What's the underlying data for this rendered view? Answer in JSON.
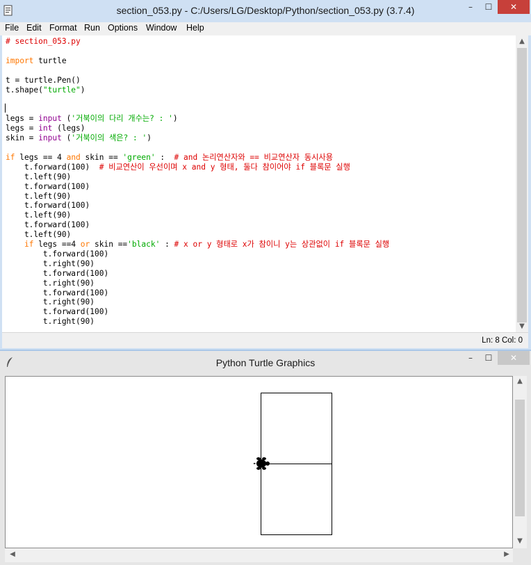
{
  "editor_window": {
    "title": "section_053.py - C:/Users/LG/Desktop/Python/section_053.py (3.7.4)",
    "controls": {
      "minimize": "–",
      "maximize": "☐",
      "close": "✕"
    },
    "menu": [
      "File",
      "Edit",
      "Format",
      "Run",
      "Options",
      "Window",
      "Help"
    ],
    "status": "Ln: 8  Col: 0"
  },
  "code_lines": [
    [
      {
        "t": "# section_053.py",
        "c": "cm"
      }
    ],
    [],
    [
      {
        "t": "import",
        "c": "kw"
      },
      {
        "t": " turtle",
        "c": ""
      }
    ],
    [],
    [
      {
        "t": "t = turtle.Pen()",
        "c": ""
      }
    ],
    [
      {
        "t": "t.shape(",
        "c": ""
      },
      {
        "t": "\"turtle\"",
        "c": "st"
      },
      {
        "t": ")",
        "c": ""
      }
    ],
    [],
    [],
    [
      {
        "t": "legs = ",
        "c": ""
      },
      {
        "t": "input",
        "c": "bi"
      },
      {
        "t": " (",
        "c": ""
      },
      {
        "t": "'거북이의 다리 개수는? : '",
        "c": "st"
      },
      {
        "t": ")",
        "c": ""
      }
    ],
    [
      {
        "t": "legs = ",
        "c": ""
      },
      {
        "t": "int",
        "c": "bi"
      },
      {
        "t": " (legs)",
        "c": ""
      }
    ],
    [
      {
        "t": "skin = ",
        "c": ""
      },
      {
        "t": "input",
        "c": "bi"
      },
      {
        "t": " (",
        "c": ""
      },
      {
        "t": "'거북이의 색은? : '",
        "c": "st"
      },
      {
        "t": ")",
        "c": ""
      }
    ],
    [],
    [
      {
        "t": "if",
        "c": "kw"
      },
      {
        "t": " legs == 4 ",
        "c": ""
      },
      {
        "t": "and",
        "c": "kw"
      },
      {
        "t": " skin == ",
        "c": ""
      },
      {
        "t": "'green'",
        "c": "st"
      },
      {
        "t": " :  ",
        "c": ""
      },
      {
        "t": "# and 논리연산자와 == 비교연산자 동시사용",
        "c": "cm"
      }
    ],
    [
      {
        "t": "    t.forward(100)  ",
        "c": ""
      },
      {
        "t": "# 비교연산이 우선이며 x and y 형태, 둘다 참이어야 if 블록문 실행",
        "c": "cm"
      }
    ],
    [
      {
        "t": "    t.left(90)",
        "c": ""
      }
    ],
    [
      {
        "t": "    t.forward(100)",
        "c": ""
      }
    ],
    [
      {
        "t": "    t.left(90)",
        "c": ""
      }
    ],
    [
      {
        "t": "    t.forward(100)",
        "c": ""
      }
    ],
    [
      {
        "t": "    t.left(90)",
        "c": ""
      }
    ],
    [
      {
        "t": "    t.forward(100)",
        "c": ""
      }
    ],
    [
      {
        "t": "    t.left(90)",
        "c": ""
      }
    ],
    [
      {
        "t": "    ",
        "c": ""
      },
      {
        "t": "if",
        "c": "kw"
      },
      {
        "t": " legs ==4 ",
        "c": ""
      },
      {
        "t": "or",
        "c": "kw"
      },
      {
        "t": " skin ==",
        "c": ""
      },
      {
        "t": "'black'",
        "c": "st"
      },
      {
        "t": " : ",
        "c": ""
      },
      {
        "t": "# x or y 형태로 x가 참이니 y는 상관없이 if 블록문 실행",
        "c": "cm"
      }
    ],
    [
      {
        "t": "        t.forward(100)",
        "c": ""
      }
    ],
    [
      {
        "t": "        t.right(90)",
        "c": ""
      }
    ],
    [
      {
        "t": "        t.forward(100)",
        "c": ""
      }
    ],
    [
      {
        "t": "        t.right(90)",
        "c": ""
      }
    ],
    [
      {
        "t": "        t.forward(100)",
        "c": ""
      }
    ],
    [
      {
        "t": "        t.right(90)",
        "c": ""
      }
    ],
    [
      {
        "t": "        t.forward(100)",
        "c": ""
      }
    ],
    [
      {
        "t": "        t.right(90)",
        "c": ""
      }
    ]
  ],
  "turtle_window": {
    "title": "Python Turtle Graphics",
    "controls": {
      "minimize": "–",
      "maximize": "☐",
      "close": "✕"
    }
  },
  "icons": {
    "editor_app_icon": "idle-document-icon",
    "turtle_app_icon": "feather-icon",
    "turtle_cursor": "turtle-shape-icon"
  },
  "colors": {
    "keyword": "#ff7700",
    "builtin": "#900090",
    "string": "#00aa00",
    "comment": "#dd0000",
    "window_frame": "#cfe0f3",
    "close_button": "#c7403a"
  }
}
